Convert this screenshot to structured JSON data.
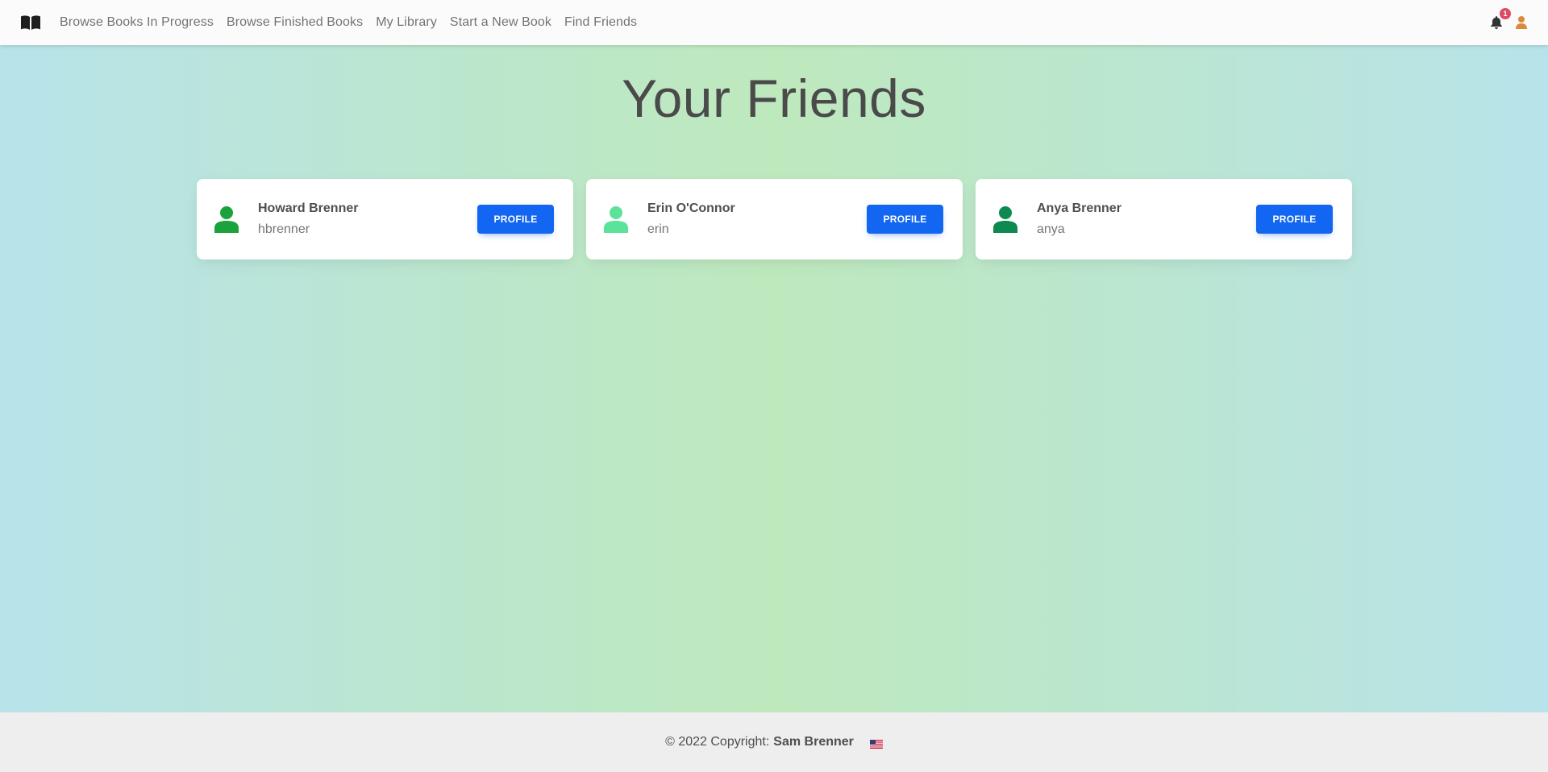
{
  "nav": {
    "brand_icon": "book-open-icon",
    "links": [
      {
        "label": "Browse Books In Progress"
      },
      {
        "label": "Browse Finished Books"
      },
      {
        "label": "My Library"
      },
      {
        "label": "Start a New Book"
      },
      {
        "label": "Find Friends"
      }
    ],
    "notifications": {
      "icon": "bell-icon",
      "count": "1"
    },
    "user_icon": "user-icon",
    "colors": {
      "user_icon": "#d98a3a",
      "badge": "#dc4c64"
    }
  },
  "main": {
    "title": "Your Friends",
    "friends": [
      {
        "name": "Howard Brenner",
        "username": "hbrenner",
        "avatar_color": "#1aa33b",
        "button": "PROFILE"
      },
      {
        "name": "Erin O'Connor",
        "username": "erin",
        "avatar_color": "#5be39a",
        "button": "PROFILE"
      },
      {
        "name": "Anya Brenner",
        "username": "anya",
        "avatar_color": "#0d8a4f",
        "button": "PROFILE"
      }
    ],
    "colors": {
      "button": "#1266f1"
    }
  },
  "footer": {
    "copyright": "© 2022 Copyright:",
    "author": "Sam Brenner",
    "flag_icon": "us-flag-icon"
  }
}
